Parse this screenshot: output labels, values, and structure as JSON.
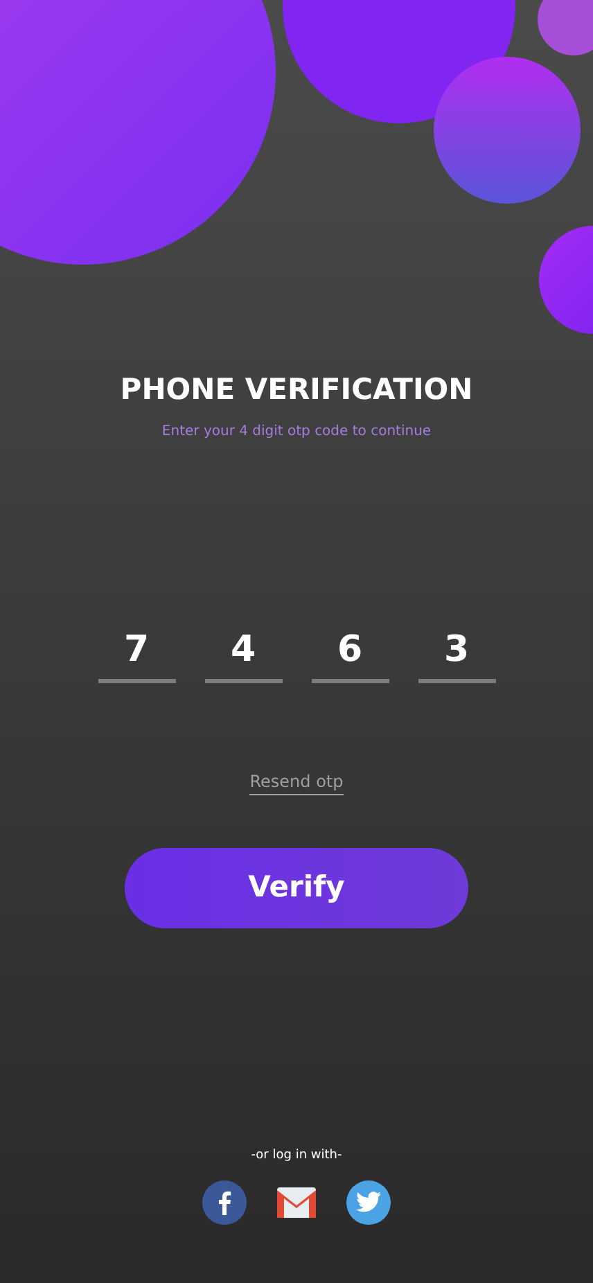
{
  "title": "PHONE VERIFICATION",
  "subtitle": "Enter your 4 digit otp code to continue",
  "otp_digits": [
    "7",
    "4",
    "6",
    "3"
  ],
  "resend_link": "Resend otp",
  "verify_button": "Verify",
  "social_login": {
    "label": "-or log in with-",
    "providers": [
      {
        "kind": "facebook"
      },
      {
        "kind": "gmail"
      },
      {
        "kind": "twitter"
      }
    ]
  }
}
